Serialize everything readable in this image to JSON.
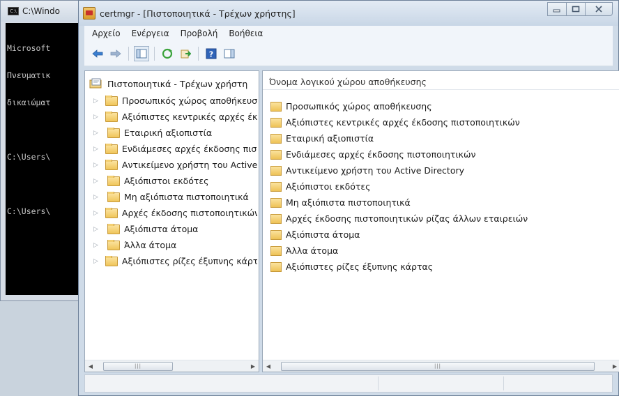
{
  "console": {
    "title": "C:\\Windo",
    "lines": [
      "Microsoft",
      "Πνευματικ",
      "δικαιώματ",
      "",
      "C:\\Users\\",
      "",
      "C:\\Users\\"
    ]
  },
  "window": {
    "title": "certmgr - [Πιστοποιητικά - Τρέχων χρήστης]"
  },
  "menu": {
    "items": [
      "Αρχείο",
      "Ενέργεια",
      "Προβολή",
      "Βοήθεια"
    ]
  },
  "toolbar": {
    "buttons": [
      "back-icon",
      "forward-icon",
      "console-tree-icon",
      "refresh-icon",
      "export-list-icon",
      "help-icon",
      "action-pane-icon"
    ]
  },
  "tree": {
    "root": "Πιστοποιητικά - Τρέχων χρήστη",
    "items": [
      "Προσωπικός χώρος αποθήκευσης",
      "Αξιόπιστες κεντρικές αρχές έκδοσης πιστοποιητικών",
      "Εταιρική αξιοπιστία",
      "Ενδιάμεσες αρχές έκδοσης πιστοποιητικών",
      "Αντικείμενο χρήστη του Active Directory",
      "Αξιόπιστοι εκδότες",
      "Μη αξιόπιστα πιστοποιητικά",
      "Αρχές έκδοσης πιστοποιητικών ρίζας άλλων εταιρειών",
      "Αξιόπιστα άτομα",
      "Άλλα άτομα",
      "Αξιόπιστες ρίζες έξυπνης κάρτας"
    ]
  },
  "list": {
    "column_header": "Όνομα λογικού χώρου αποθήκευσης",
    "items": [
      "Προσωπικός χώρος αποθήκευσης",
      "Αξιόπιστες κεντρικές αρχές έκδοσης πιστοποιητικών",
      "Εταιρική αξιοπιστία",
      "Ενδιάμεσες αρχές έκδοσης πιστοποιητικών",
      "Αντικείμενο χρήστη του Active Directory",
      "Αξιόπιστοι εκδότες",
      "Μη αξιόπιστα πιστοποιητικά",
      "Αρχές έκδοσης πιστοποιητικών ρίζας άλλων εταιρειών",
      "Αξιόπιστα άτομα",
      "Άλλα άτομα",
      "Αξιόπιστες ρίζες έξυπνης κάρτας"
    ]
  },
  "colors": {
    "folder": "#f0c55a",
    "window_frame": "#cfdbe8",
    "console_bg": "#000000"
  }
}
